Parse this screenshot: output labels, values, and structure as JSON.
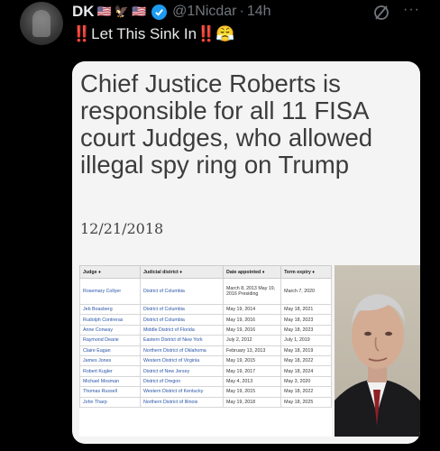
{
  "post": {
    "display_name": "DK",
    "handle": "@1Nicdar",
    "separator": "·",
    "time": "14h",
    "text": "‼️Let This Sink In‼️😤"
  },
  "card": {
    "headline": "Chief Justice Roberts is responsible for all 11 FISA court Judges, who allowed illegal spy ring on Trump",
    "date": "12/21/2018",
    "table": {
      "headers": [
        "Judge ♦",
        "Judicial district ♦",
        "Date appointed ♦",
        "Term expiry ♦"
      ],
      "rows": [
        {
          "judge": "Rosemary Collyer",
          "district": "District of Columbia",
          "appointed": "March 8, 2013 May 19, 2016 Presiding",
          "expiry": "March 7, 2020"
        },
        {
          "judge": "Jeb Boasberg",
          "district": "District of Columbia",
          "appointed": "May 19, 2014",
          "expiry": "May 18, 2021"
        },
        {
          "judge": "Rudolph Contreras",
          "district": "District of Columbia",
          "appointed": "May 19, 2016",
          "expiry": "May 18, 2023"
        },
        {
          "judge": "Anne Conway",
          "district": "Middle District of Florida",
          "appointed": "May 19, 2016",
          "expiry": "May 18, 2023"
        },
        {
          "judge": "Raymond Dearie",
          "district": "Eastern District of New York",
          "appointed": "July 2, 2012",
          "expiry": "July 1, 2019"
        },
        {
          "judge": "Claire Eagan",
          "district": "Northern District of Oklahoma",
          "appointed": "February 13, 2013",
          "expiry": "May 18, 2019"
        },
        {
          "judge": "James Jones",
          "district": "Western District of Virginia",
          "appointed": "May 19, 2015",
          "expiry": "May 18, 2022"
        },
        {
          "judge": "Robert Kugler",
          "district": "District of New Jersey",
          "appointed": "May 19, 2017",
          "expiry": "May 18, 2024"
        },
        {
          "judge": "Michael Mosman",
          "district": "District of Oregon",
          "appointed": "May 4, 2013",
          "expiry": "May 3, 2020"
        },
        {
          "judge": "Thomas Russell",
          "district": "Western District of Kentucky",
          "appointed": "May 19, 2015",
          "expiry": "May 18, 2022"
        },
        {
          "judge": "John Tharp",
          "district": "Northern District of Illinois",
          "appointed": "May 19, 2018",
          "expiry": "May 18, 2025"
        }
      ]
    }
  },
  "colors": {
    "background": "#000000",
    "verified": "#1d9bf0",
    "muted": "#71767b",
    "link": "#2a55a8"
  },
  "icons": [
    "flag-us-icon",
    "eagle-icon",
    "verified-badge-icon",
    "grok-icon",
    "more-icon"
  ]
}
